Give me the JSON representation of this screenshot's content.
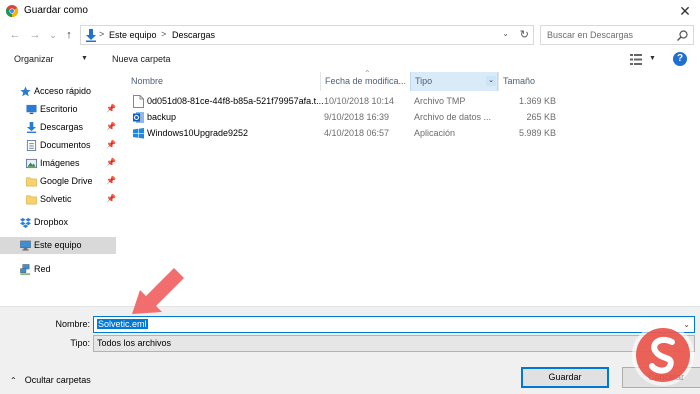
{
  "window": {
    "title": "Guardar como",
    "close_glyph": "✕"
  },
  "nav": {
    "back_glyph": "←",
    "forward_glyph": "→",
    "recent_glyph": "⌄",
    "up_glyph": "↑",
    "breadcrumbs": [
      "Este equipo",
      "Descargas"
    ],
    "sep_glyph": ">",
    "search_placeholder": "Buscar en Descargas"
  },
  "toolbar": {
    "organize": "Organizar",
    "new_folder": "Nueva carpeta",
    "help": "?"
  },
  "sidebar": {
    "items": [
      {
        "label": "Acceso rápido",
        "icon": "star-icon",
        "pinned": false
      },
      {
        "label": "Escritorio",
        "icon": "desktop-icon",
        "pinned": true
      },
      {
        "label": "Descargas",
        "icon": "download-icon",
        "pinned": true
      },
      {
        "label": "Documentos",
        "icon": "documents-icon",
        "pinned": true
      },
      {
        "label": "Imágenes",
        "icon": "pictures-icon",
        "pinned": true
      },
      {
        "label": "Google Drive",
        "icon": "folder-icon",
        "pinned": true
      },
      {
        "label": "Solvetic",
        "icon": "folder-icon",
        "pinned": true
      },
      {
        "label": "Dropbox",
        "icon": "dropbox-icon",
        "pinned": false
      },
      {
        "label": "Este equipo",
        "icon": "computer-icon",
        "pinned": false
      },
      {
        "label": "Red",
        "icon": "network-icon",
        "pinned": false
      }
    ],
    "selected_label": "Este equipo"
  },
  "columns": {
    "name": "Nombre",
    "date": "Fecha de modifica...",
    "type": "Tipo",
    "size": "Tamaño"
  },
  "files": [
    {
      "name": "0d051d08-81ce-44f8-b85a-521f79957afa.t...",
      "date": "10/10/2018 10:14",
      "type": "Archivo TMP",
      "size": "1.369 KB",
      "icon": "file-icon"
    },
    {
      "name": "backup",
      "date": "9/10/2018 16:39",
      "type": "Archivo de datos ...",
      "size": "265 KB",
      "icon": "outlook-data-icon"
    },
    {
      "name": "Windows10Upgrade9252",
      "date": "4/10/2018 06:57",
      "type": "Aplicación",
      "size": "5.989 KB",
      "icon": "windows-app-icon"
    }
  ],
  "form": {
    "name_label": "Nombre:",
    "name_value": "Solvetic.eml",
    "type_label": "Tipo:",
    "type_value": "Todos los archivos"
  },
  "footer": {
    "hide_folders": "Ocultar carpetas",
    "save": "Guardar",
    "cancel": "Cancelar"
  },
  "colors": {
    "accent": "#0078d7",
    "selection": "#d9d9d9",
    "arrow": "#f26d6d",
    "logo": "#e8463c"
  }
}
